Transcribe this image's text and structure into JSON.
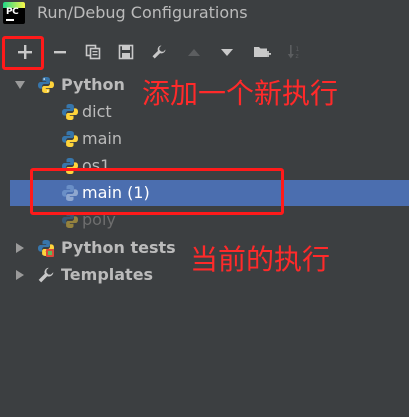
{
  "window": {
    "title": "Run/Debug Configurations",
    "app_icon_text": "PC"
  },
  "toolbar": {
    "buttons": [
      {
        "name": "add",
        "icon": "plus-icon"
      },
      {
        "name": "remove",
        "icon": "minus-icon"
      },
      {
        "name": "copy",
        "icon": "copy-icon"
      },
      {
        "name": "save",
        "icon": "save-icon"
      },
      {
        "name": "edit-defaults",
        "icon": "wrench-icon"
      },
      {
        "name": "move-up",
        "icon": "triangle-up-icon"
      },
      {
        "name": "move-down",
        "icon": "triangle-down-icon"
      },
      {
        "name": "new-folder",
        "icon": "folder-add-icon"
      },
      {
        "name": "sort",
        "icon": "sort-az-icon"
      }
    ]
  },
  "tree": {
    "python": {
      "label": "Python",
      "children": [
        "dict",
        "main",
        "os1",
        "main (1)",
        "poly"
      ]
    },
    "python_tests": {
      "label": "Python tests"
    },
    "templates": {
      "label": "Templates"
    }
  },
  "annotations": {
    "add_note": "添加一个新执行",
    "current_note": "当前的执行"
  },
  "colors": {
    "background": "#3c3f41",
    "selection": "#4b6eaf",
    "annotation": "#ff2a2a",
    "python_blue": "#3776ab",
    "python_yellow": "#ffd43b"
  }
}
